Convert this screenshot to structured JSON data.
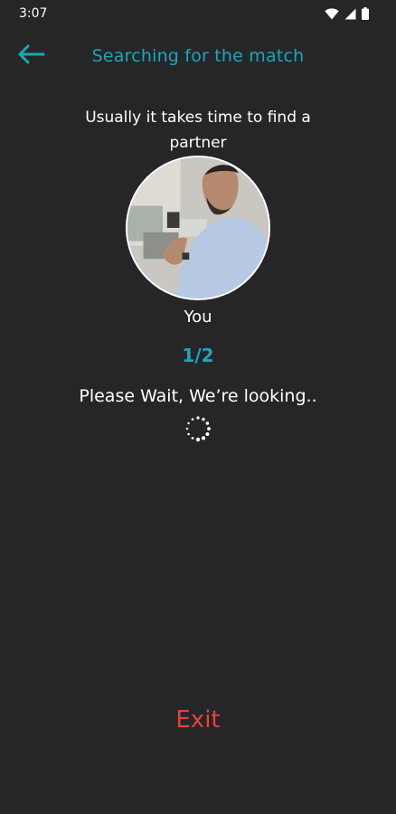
{
  "status_bar": {
    "time": "3:07",
    "icons": [
      "wifi-icon",
      "cellular-icon",
      "battery-icon"
    ]
  },
  "app_bar": {
    "back_icon": "arrow-left-icon",
    "title": "Searching for the match"
  },
  "main": {
    "subtitle": "Usually it takes time to find a partner",
    "avatar_label": "You",
    "counter": "1/2",
    "wait_text": "Please Wait, We’re looking..",
    "loading_icon": "loading-spinner-icon"
  },
  "footer": {
    "exit_label": "Exit"
  },
  "colors": {
    "background": "#262628",
    "accent": "#1ba7b8",
    "exit": "#e0443e",
    "text": "#ffffff"
  }
}
